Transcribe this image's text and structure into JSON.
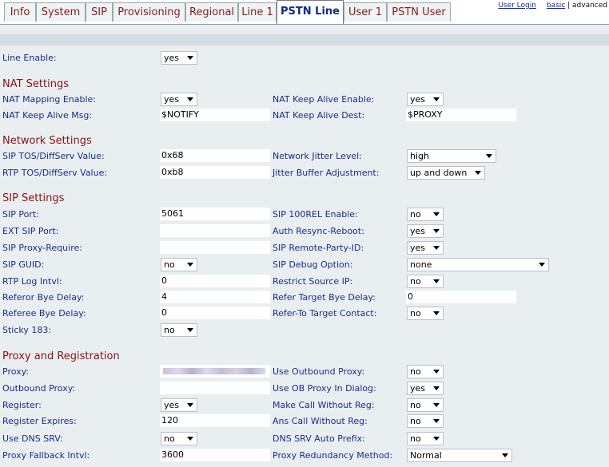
{
  "tabs": [
    "Info",
    "System",
    "SIP",
    "Provisioning",
    "Regional",
    "Line 1",
    "PSTN Line",
    "User 1",
    "PSTN User"
  ],
  "active_tab": "PSTN Line",
  "top_links": {
    "user_login": "User Login",
    "basic": "basic",
    "sep": "|",
    "advanced": "advanced"
  },
  "line_enable": {
    "label": "Line Enable:",
    "value": "yes"
  },
  "nat": {
    "title": "NAT Settings",
    "mapping_enable": {
      "label": "NAT Mapping Enable:",
      "value": "yes"
    },
    "keep_alive_enable": {
      "label": "NAT Keep Alive Enable:",
      "value": "yes"
    },
    "keep_alive_msg": {
      "label": "NAT Keep Alive Msg:",
      "value": "$NOTIFY"
    },
    "keep_alive_dest": {
      "label": "NAT Keep Alive Dest:",
      "value": "$PROXY"
    }
  },
  "network": {
    "title": "Network Settings",
    "sip_tos": {
      "label": "SIP TOS/DiffServ Value:",
      "value": "0x68"
    },
    "jitter_level": {
      "label": "Network Jitter Level:",
      "value": "high"
    },
    "rtp_tos": {
      "label": "RTP TOS/DiffServ Value:",
      "value": "0xb8"
    },
    "jitter_adj": {
      "label": "Jitter Buffer Adjustment:",
      "value": "up and down"
    }
  },
  "sip": {
    "title": "SIP Settings",
    "sip_port": {
      "label": "SIP Port:",
      "value": "5061"
    },
    "rel100": {
      "label": "SIP 100REL Enable:",
      "value": "no"
    },
    "ext_sip_port": {
      "label": "EXT SIP Port:",
      "value": ""
    },
    "auth_resync": {
      "label": "Auth Resync-Reboot:",
      "value": "yes"
    },
    "proxy_require": {
      "label": "SIP Proxy-Require:",
      "value": ""
    },
    "remote_party": {
      "label": "SIP Remote-Party-ID:",
      "value": "yes"
    },
    "guid": {
      "label": "SIP GUID:",
      "value": "no"
    },
    "debug": {
      "label": "SIP Debug Option:",
      "value": "none"
    },
    "rtp_log": {
      "label": "RTP Log Intvl:",
      "value": "0"
    },
    "restrict_ip": {
      "label": "Restrict Source IP:",
      "value": "no"
    },
    "referor_bye": {
      "label": "Referor Bye Delay:",
      "value": "4"
    },
    "refer_target_bye": {
      "label": "Refer Target Bye Delay:",
      "value": "0"
    },
    "referee_bye": {
      "label": "Referee Bye Delay:",
      "value": "0"
    },
    "refer_to_target": {
      "label": "Refer-To Target Contact:",
      "value": "no"
    },
    "sticky183": {
      "label": "Sticky 183:",
      "value": "no"
    }
  },
  "proxy": {
    "title": "Proxy and Registration",
    "proxy": {
      "label": "Proxy:",
      "value": ""
    },
    "use_outbound": {
      "label": "Use Outbound Proxy:",
      "value": "no"
    },
    "outbound_proxy": {
      "label": "Outbound Proxy:",
      "value": ""
    },
    "use_ob_dialog": {
      "label": "Use OB Proxy In Dialog:",
      "value": "yes"
    },
    "register": {
      "label": "Register:",
      "value": "yes"
    },
    "make_call_wo_reg": {
      "label": "Make Call Without Reg:",
      "value": "no"
    },
    "register_expires": {
      "label": "Register Expires:",
      "value": "120"
    },
    "ans_call_wo_reg": {
      "label": "Ans Call Without Reg:",
      "value": "no"
    },
    "dns_srv": {
      "label": "Use DNS SRV:",
      "value": "no"
    },
    "dns_srv_prefix": {
      "label": "DNS SRV Auto Prefix:",
      "value": "no"
    },
    "fallback": {
      "label": "Proxy Fallback Intvl:",
      "value": "3600"
    },
    "redundancy": {
      "label": "Proxy Redundancy Method:",
      "value": "Normal"
    }
  }
}
